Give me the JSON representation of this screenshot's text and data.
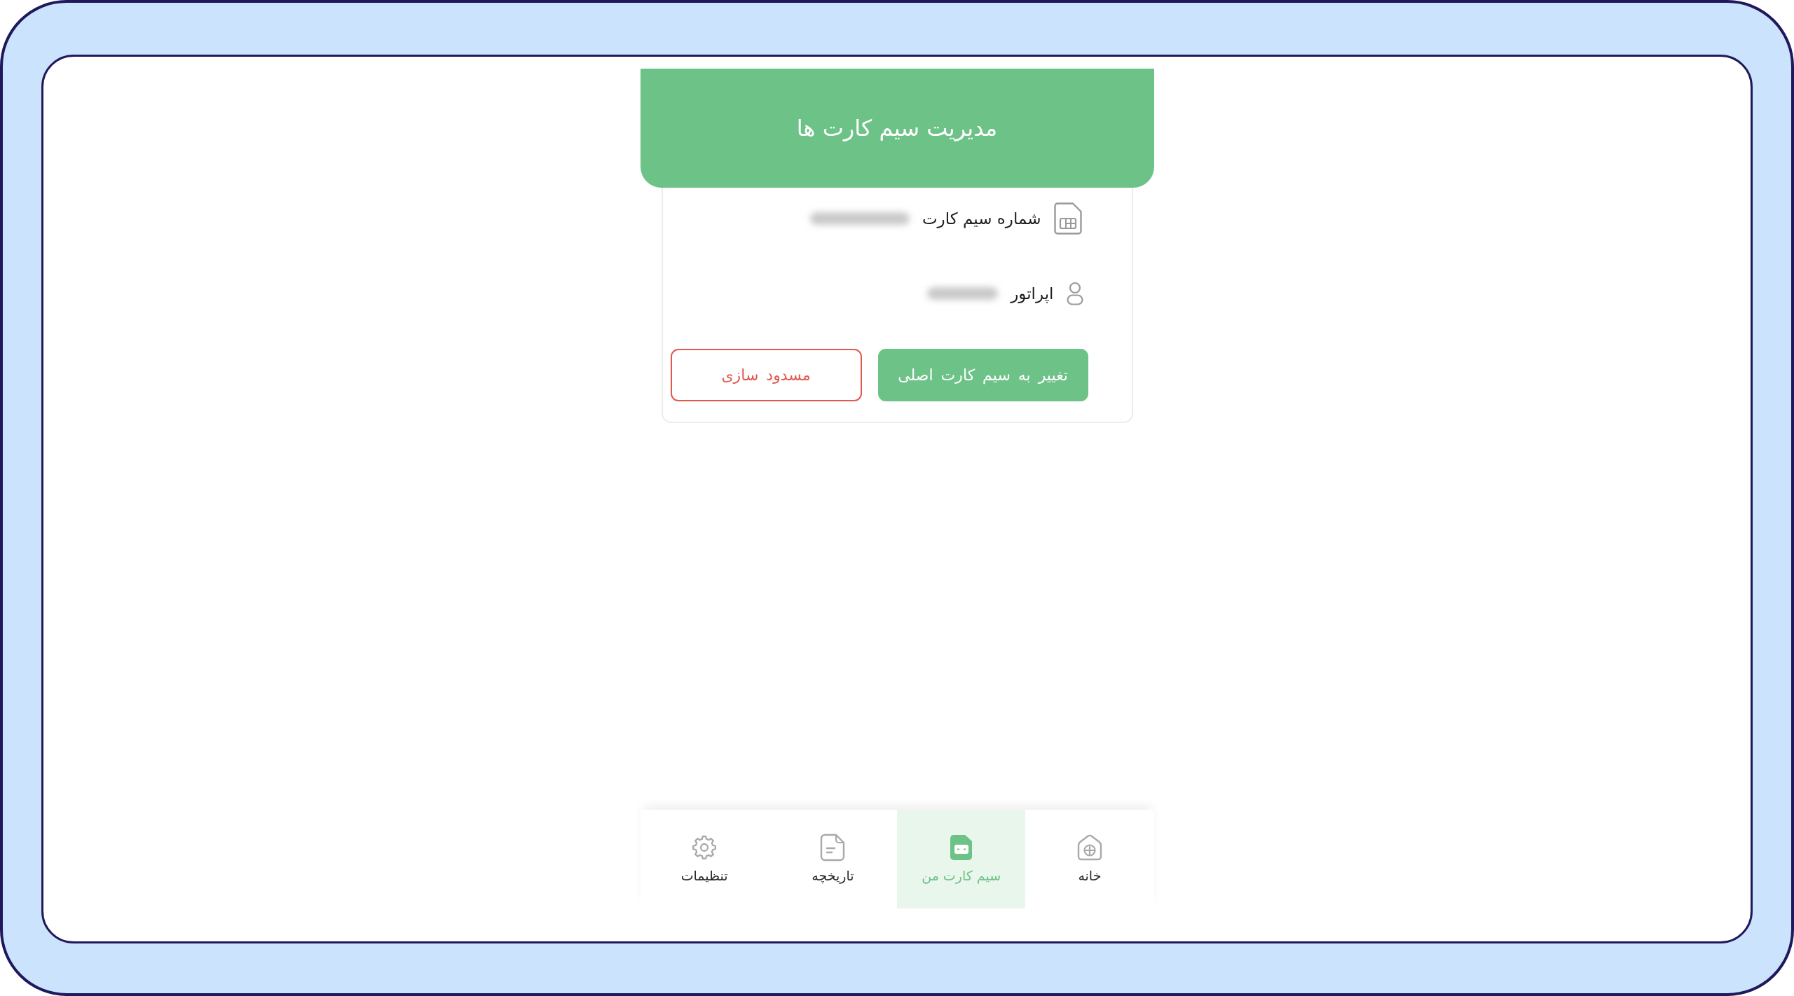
{
  "header": {
    "title": "مدیریت سیم کارت ها"
  },
  "details": [
    {
      "kind": "sim",
      "label": "شماره سیم کارت",
      "redacted": true
    },
    {
      "kind": "operator",
      "label": "اپراتور",
      "redacted": true
    }
  ],
  "actions": [
    {
      "kind": "primary",
      "label": "تغییر به سیم کارت اصلی"
    },
    {
      "kind": "danger",
      "label": "مسدود سازی"
    }
  ],
  "bottom_nav": [
    {
      "kind": "home",
      "label": "خانه",
      "selected": false
    },
    {
      "kind": "sim",
      "label": "سیم کارت من",
      "selected": true
    },
    {
      "kind": "history",
      "label": "تاریخچه",
      "selected": false
    },
    {
      "kind": "settings",
      "label": "تنظیمات",
      "selected": false
    }
  ]
}
